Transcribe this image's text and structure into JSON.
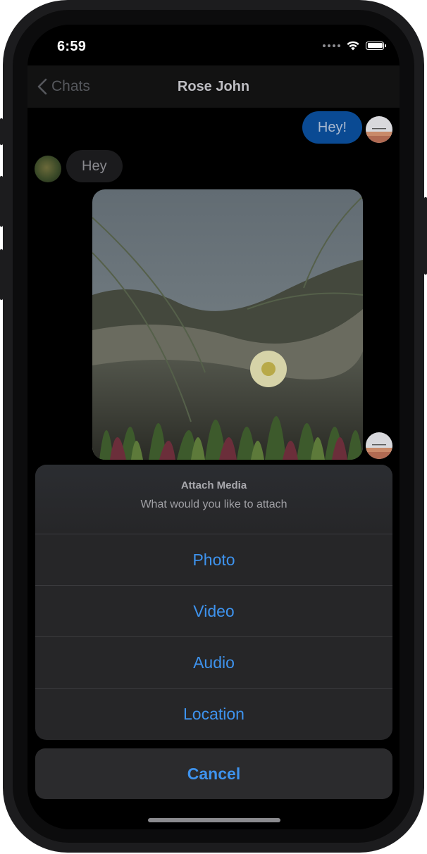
{
  "status_bar": {
    "time": "6:59"
  },
  "nav": {
    "back_label": "Chats",
    "title": "Rose John"
  },
  "messages": {
    "outgoing_text": "Hey!",
    "incoming_text": "Hey"
  },
  "action_sheet": {
    "title": "Attach Media",
    "message": "What would you like to attach",
    "options": [
      "Photo",
      "Video",
      "Audio",
      "Location"
    ],
    "cancel_label": "Cancel"
  },
  "colors": {
    "accent": "#3e93ee",
    "outgoing_bubble": "#0a4a93",
    "sheet_background": "#262628"
  }
}
